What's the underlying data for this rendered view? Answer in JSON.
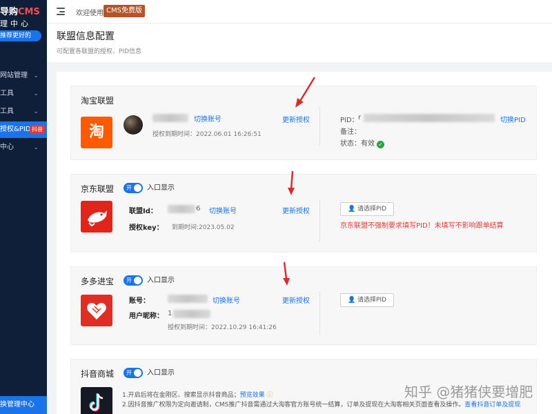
{
  "sidebar": {
    "logo_prefix": "导购",
    "logo_brand": "CMS",
    "logo_subtitle": "理中心",
    "logo_tag": "推荐更好的",
    "items": [
      {
        "label": "网站管理",
        "chevron": "⌄"
      },
      {
        "label": "工具",
        "chevron": "⌄"
      },
      {
        "label": "工具",
        "chevron": "⌄"
      },
      {
        "label": "授权&PID",
        "badge": "抖音",
        "active": true
      },
      {
        "label": "中心",
        "chevron": "⌄"
      }
    ],
    "footer": "换管理中心"
  },
  "topbar": {
    "welcome": "欢迎使用",
    "cms_badge": "CMS免费版",
    "menu_icon": "menu-fold-icon"
  },
  "page": {
    "title": "联盟信息配置",
    "subtitle": "可配置各联盟的授权、PID信息"
  },
  "cards": {
    "taobao": {
      "title": "淘宝联盟",
      "logo_glyph": "淘",
      "switch_account": "切换账号",
      "update_auth": "更新授权",
      "expire": "授权到期时间：2022.06.01 16:26:51",
      "pid_label": "PID：",
      "pid_prefix": "r",
      "switch_pid": "切换PID",
      "note_label": "备注：",
      "status_label": "状态：有效",
      "status_mark": "✓",
      "brand_color": "#ff5a00"
    },
    "jd": {
      "title": "京东联盟",
      "toggle": "开",
      "entry": "入口显示",
      "union_id_label": "联盟Id：",
      "union_id_suffix": "6",
      "switch_account": "切换账号",
      "update_auth": "更新授权",
      "key_label": "授权key：",
      "expire": "到期时间:2023.05.02",
      "pick_pid": "请选择PID",
      "warning": "京东联盟不强制要求填写PID！未填写不影响跟单结算",
      "brand_color": "#e1251b"
    },
    "pdd": {
      "title": "多多进宝",
      "toggle": "开",
      "entry": "入口显示",
      "account_label": "账号：",
      "switch_account": "切换账号",
      "update_auth": "更新授权",
      "nickname_label": "用户昵称：",
      "nickname_prefix": "1",
      "expire": "授权到期时间：2022.10.29 16:41:26",
      "pick_pid": "请选择PID",
      "brand_color": "#e02e24"
    },
    "douyin": {
      "title": "抖音商城",
      "toggle": "开",
      "entry": "入口显示",
      "line1": "1.开启后将在金刚区、搜索显示抖音商品；",
      "line1_link": "预览效果",
      "line2": "2.因抖音推广权限为定向邀请制，CMS推广抖音需通过大淘客官方账号统一结算，订单及提现在大淘客相关页面查看及操作。",
      "line2_link": "查看抖音订单及提现",
      "brand_color": "#161823"
    }
  },
  "watermark": "知乎 @猪猪侠要增肥"
}
